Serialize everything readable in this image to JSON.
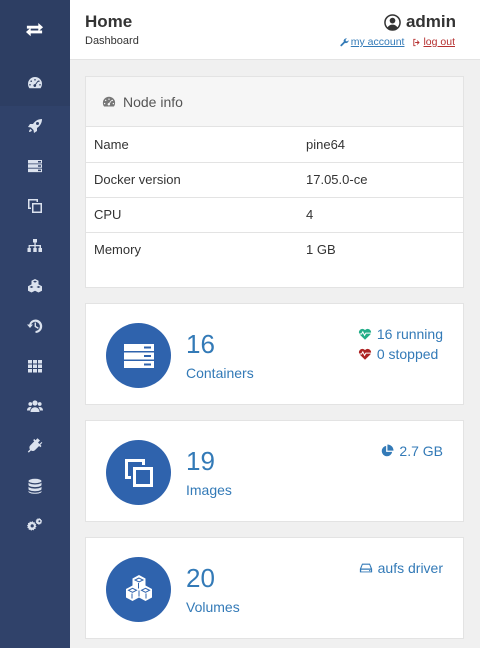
{
  "header": {
    "title": "Home",
    "breadcrumb": "Dashboard",
    "user": "admin",
    "my_account": "my account",
    "log_out": "log out"
  },
  "sidebar": {
    "items": [
      {
        "icon": "dashboard-icon",
        "active": true
      },
      {
        "icon": "rocket-icon"
      },
      {
        "icon": "server-icon"
      },
      {
        "icon": "clone-icon"
      },
      {
        "icon": "sitemap-icon"
      },
      {
        "icon": "cubes-icon"
      },
      {
        "icon": "history-icon"
      },
      {
        "icon": "grid-icon"
      },
      {
        "icon": "users-icon"
      },
      {
        "icon": "plug-icon"
      },
      {
        "icon": "database-icon"
      },
      {
        "icon": "cogs-icon"
      }
    ]
  },
  "node_info": {
    "title": "Node info",
    "rows": [
      {
        "label": "Name",
        "value": "pine64"
      },
      {
        "label": "Docker version",
        "value": "17.05.0-ce"
      },
      {
        "label": "CPU",
        "value": "4"
      },
      {
        "label": "Memory",
        "value": "1 GB"
      }
    ]
  },
  "containers": {
    "count": "16",
    "label": "Containers",
    "running": "16 running",
    "stopped": "0 stopped"
  },
  "images": {
    "count": "19",
    "label": "Images",
    "size": "2.7 GB"
  },
  "volumes": {
    "count": "20",
    "label": "Volumes",
    "driver": "aufs driver"
  },
  "colors": {
    "sidebar": "#30426a",
    "accent": "#337ab7",
    "circle": "#2f63ad",
    "running": "#23ae89",
    "stopped": "#ae2323"
  }
}
